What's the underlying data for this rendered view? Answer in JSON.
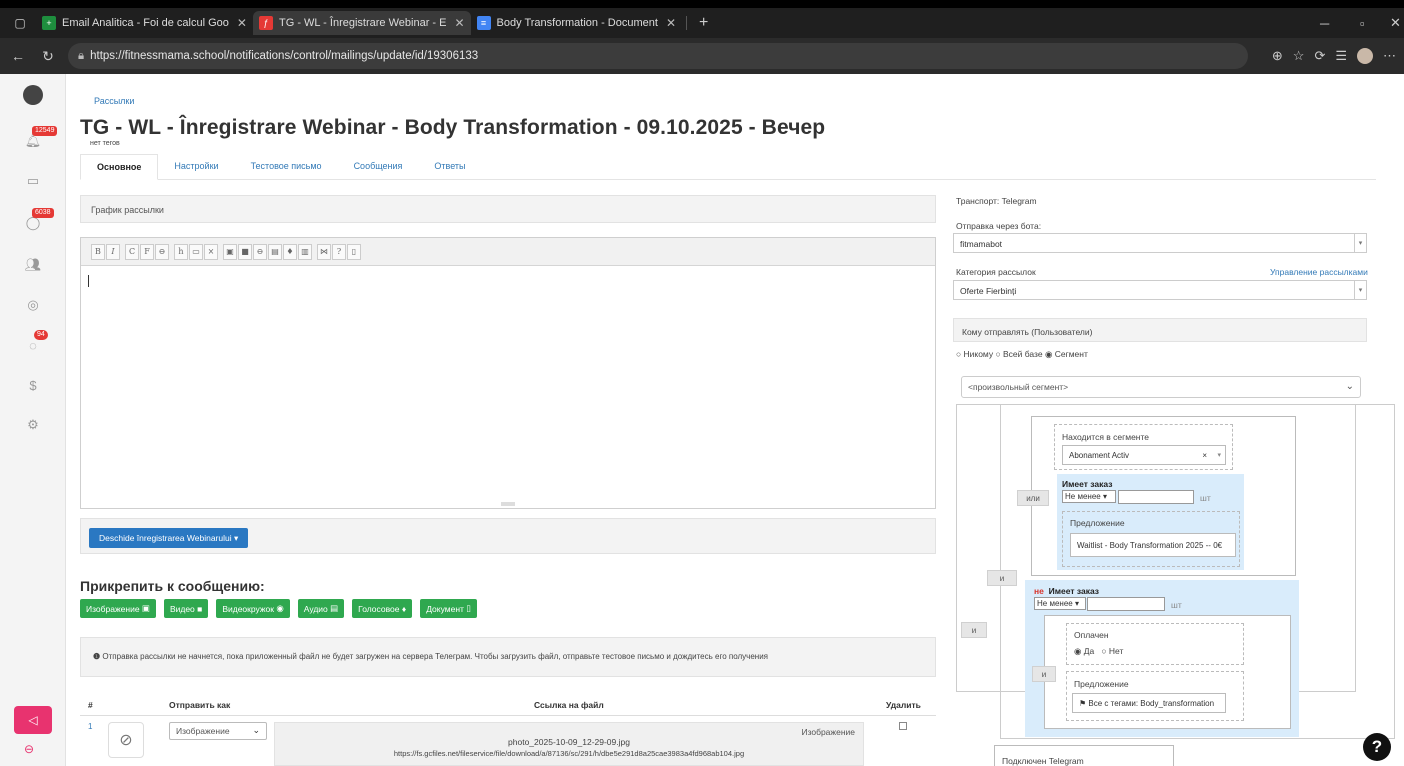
{
  "browser": {
    "tabs": [
      {
        "title": "Email Analitica - Foi de calcul Goo",
        "favicon_color": "#1e8e3e"
      },
      {
        "title": "TG - WL - Înregistrare Webinar - E",
        "favicon_color": "#e53935"
      },
      {
        "title": "Body Transformation - Document",
        "favicon_color": "#4285f4"
      }
    ],
    "url": "https://fitnessmama.school/notifications/control/mailings/update/id/19306133"
  },
  "sidebar": {
    "badges": [
      "12549",
      "6038",
      "94"
    ]
  },
  "header": {
    "breadcrumb": "Рассылки",
    "title": "TG - WL - Înregistrare Webinar - Body Transformation - 09.10.2025 - Вечер",
    "tags": "нет тегов"
  },
  "tabs": [
    "Основное",
    "Настройки",
    "Тестовое письмо",
    "Сообщения",
    "Ответы"
  ],
  "schedule_label": "График рассылки",
  "toolbar": [
    "B",
    "I",
    "C",
    "F",
    "⊖",
    "h",
    "▭",
    "×",
    "▣",
    "■",
    "⊖",
    "▤",
    "♦",
    "▥",
    "⋈",
    "?",
    "▯"
  ],
  "main_button": "Deschide înregistrarea Webinarului ▾",
  "attach": {
    "title": "Прикрепить к сообщению:",
    "buttons": [
      "Изображение",
      "Видео",
      "Видеокружок",
      "Аудио",
      "Голосовое",
      "Документ"
    ]
  },
  "notice": "Отправка рассылки не начнется, пока приложенный файл не будет загружен на сервера Телеграм. Чтобы загрузить файл, отправьте тестовое письмо и дождитесь его получения",
  "files_table": {
    "headers": [
      "#",
      "Отправить как",
      "Ссылка на файл",
      "Удалить"
    ],
    "rows": [
      {
        "num": "1",
        "send_as": "Изображение",
        "filename": "photo_2025-10-09_12-29-09.jpg",
        "url": "https://fs.gcfiles.net/fileservice/file/download/a/87136/sc/291/h/dbe5e291d8a25cae3983a4fd968ab104.jpg",
        "type": "Изображение"
      }
    ]
  },
  "right": {
    "transport": "Транспорт: Telegram",
    "bot_label": "Отправка через бота:",
    "bot_value": "fitmamabot",
    "category_label": "Категория рассылок",
    "category_link": "Управление рассылками",
    "category_value": "Oferte Fierbinți",
    "recipients_head": "Кому отправлять (Пользователи)",
    "radios": [
      "Никому",
      "Всей базе",
      "Сегмент"
    ],
    "segment_select": "<произвольный сегмент>",
    "segment": {
      "in_segment_label": "Находится в сегменте",
      "in_segment_value": "Abonament Activ",
      "or_label": "или",
      "and_label": "и",
      "has_order": "Имеет заказ",
      "not_word": "не",
      "min_option": "Не менее",
      "pcs": "шт",
      "offer_label": "Предложение",
      "offer1": "Waitlist - Body Transformation 2025 -- 0€",
      "paid_label": "Оплачен",
      "paid_yes": "Да",
      "paid_no": "Нет",
      "offer2": "Все с тегами: Body_transformation",
      "telegram_label": "Подключен Telegram"
    }
  },
  "help": "?"
}
